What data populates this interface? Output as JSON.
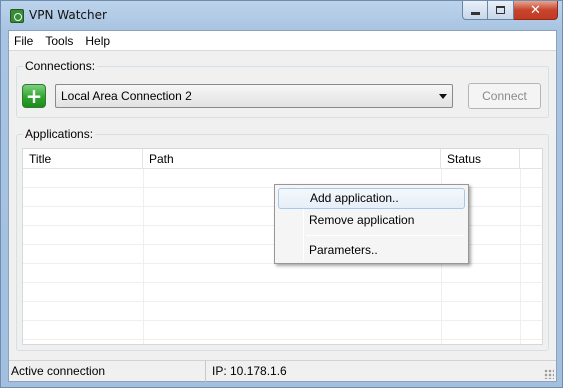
{
  "window": {
    "title": "VPN Watcher",
    "close_glyph": "✕"
  },
  "menu": {
    "items": [
      "File",
      "Tools",
      "Help"
    ]
  },
  "connections": {
    "label": "Connections:",
    "add_glyph": "+",
    "selected": "Local Area Connection 2",
    "connect_label": "Connect",
    "connect_enabled": false
  },
  "applications": {
    "label": "Applications:",
    "columns": [
      "Title",
      "Path",
      "Status",
      ""
    ],
    "rows": []
  },
  "context_menu": {
    "items": [
      "Add application..",
      "Remove application",
      "Parameters.."
    ],
    "highlighted": "Add application.."
  },
  "status_bar": {
    "left": "Active connection",
    "right": "IP: 10.178.1.6"
  },
  "colors": {
    "accent_green": "#2ea52e",
    "close_red": "#c7452d"
  }
}
